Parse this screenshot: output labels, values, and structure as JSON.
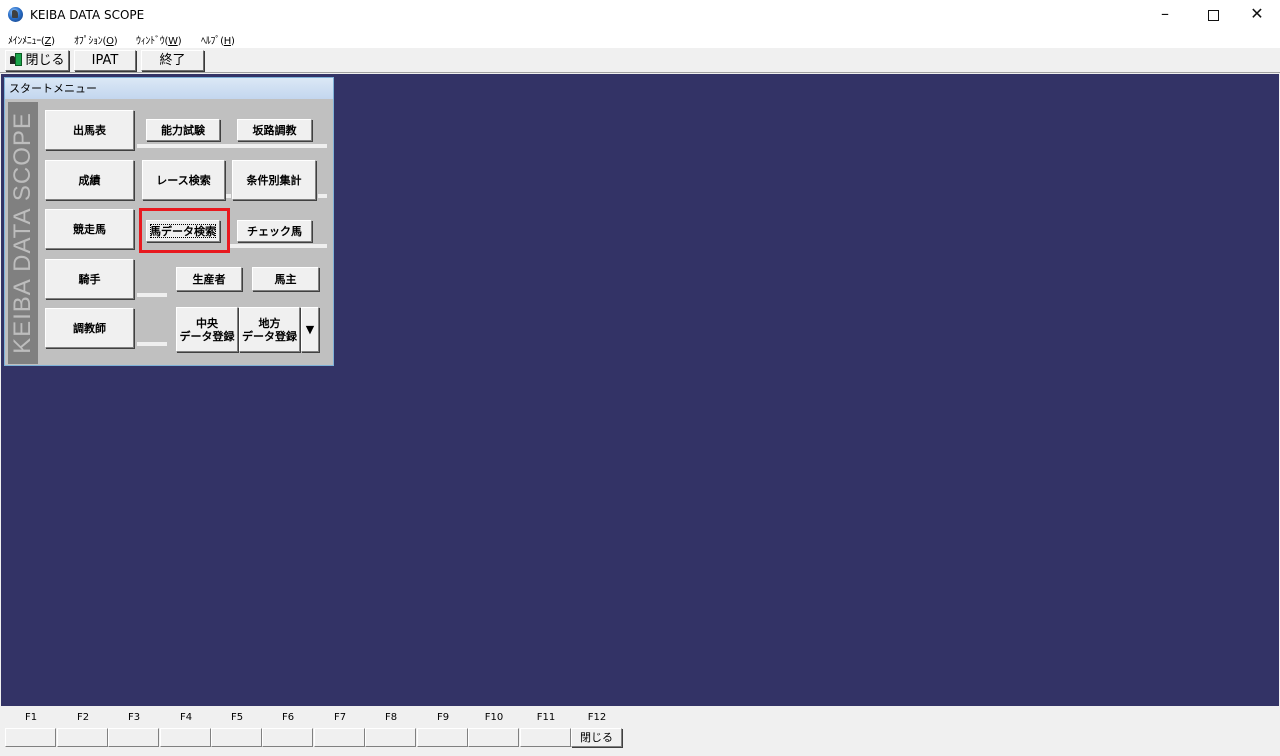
{
  "window": {
    "title": "KEIBA DATA SCOPE"
  },
  "menu": [
    {
      "label": "ﾒｲﾝﾒﾆｭｰ(",
      "accel": "Z",
      "close": ")"
    },
    {
      "label": "ｵﾌﾟｼｮﾝ(",
      "accel": "O",
      "close": ")"
    },
    {
      "label": "ｳｨﾝﾄﾞｳ(",
      "accel": "W",
      "close": ")"
    },
    {
      "label": "ﾍﾙﾌﾟ(",
      "accel": "H",
      "close": ")"
    }
  ],
  "toolbar": {
    "close_label": "閉じる",
    "ipat_label": "IPAT",
    "exit_label": "終了"
  },
  "start_menu": {
    "title": "スタートメニュー",
    "side_text": "KEIBA DATA SCOPE",
    "buttons": {
      "shutsuba": "出馬表",
      "noryoku": "能力試験",
      "hanro": "坂路調教",
      "seiseki": "成績",
      "race_search": "レース検索",
      "joken": "条件別集計",
      "kyosoba": "競走馬",
      "uma_search": "馬データ検索",
      "check_uma": "チェック馬",
      "kishu": "騎手",
      "seisansha": "生産者",
      "banushi": "馬主",
      "chokyoshi": "調教師",
      "chuo_line1": "中央",
      "chuo_line2": "データ登録",
      "chiho_line1": "地方",
      "chiho_line2": "データ登録",
      "dropdown": "▼"
    }
  },
  "fkeys": [
    {
      "key": "F1",
      "label": ""
    },
    {
      "key": "F2",
      "label": ""
    },
    {
      "key": "F3",
      "label": ""
    },
    {
      "key": "F4",
      "label": ""
    },
    {
      "key": "F5",
      "label": ""
    },
    {
      "key": "F6",
      "label": ""
    },
    {
      "key": "F7",
      "label": ""
    },
    {
      "key": "F8",
      "label": ""
    },
    {
      "key": "F9",
      "label": ""
    },
    {
      "key": "F10",
      "label": ""
    },
    {
      "key": "F11",
      "label": ""
    },
    {
      "key": "F12",
      "label": "閉じる"
    }
  ],
  "colors": {
    "mdi_background": "#333366",
    "highlight": "#e8191f"
  }
}
